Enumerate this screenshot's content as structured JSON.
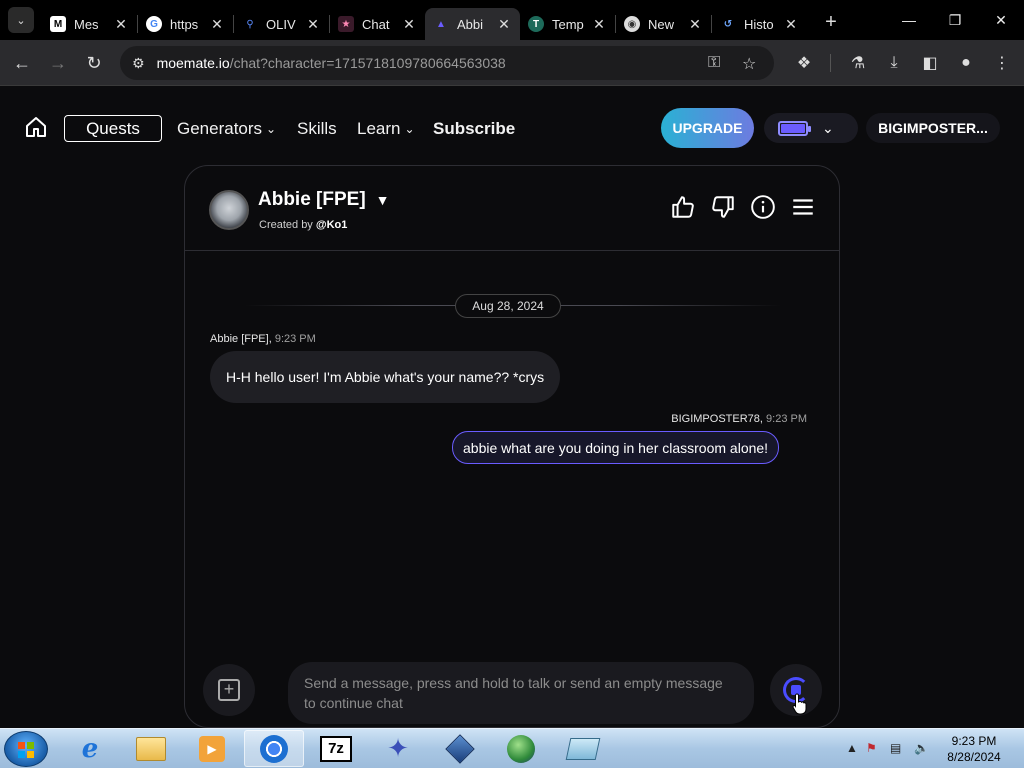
{
  "browser": {
    "tabs": [
      {
        "title": "Mes",
        "favicon": "M",
        "active": false
      },
      {
        "title": "https",
        "favicon": "G",
        "active": false
      },
      {
        "title": "OLIV",
        "favicon": "Q",
        "active": false
      },
      {
        "title": "Chat",
        "favicon": "C",
        "active": false
      },
      {
        "title": "Abbi",
        "favicon": "A",
        "active": true
      },
      {
        "title": "Temp",
        "favicon": "T",
        "active": false
      },
      {
        "title": "New",
        "favicon": "N",
        "active": false
      },
      {
        "title": "Histo",
        "favicon": "H",
        "active": false
      }
    ],
    "url_domain": "moemate.io",
    "url_path": "/chat?character=1715718109780664563038"
  },
  "site": {
    "nav": {
      "quests": "Quests",
      "generators": "Generators",
      "skills": "Skills",
      "learn": "Learn",
      "subscribe": "Subscribe"
    },
    "upgrade_label": "UPGRADE",
    "username": "BIGIMPOSTER..."
  },
  "chat": {
    "character_name": "Abbie [FPE]",
    "created_by_prefix": "Created by",
    "creator": "@Ko1",
    "date": "Aug 28, 2024",
    "messages": [
      {
        "author": "Abbie [FPE]",
        "time": "9:23 PM",
        "text": "H-H hello user! I'm Abbie what's your name?? *crys"
      },
      {
        "author": "BIGIMPOSTER78",
        "time": "9:23 PM",
        "text": "abbie what are you doing in her classroom alone!"
      }
    ],
    "input_placeholder": "Send a message, press and hold to talk or send an empty message to continue chat"
  },
  "taskbar": {
    "time": "9:23 PM",
    "date": "8/28/2024"
  },
  "colors": {
    "accent": "#6a5cff",
    "upgrade_start": "#2ab1d4",
    "upgrade_end": "#6d7be0"
  }
}
